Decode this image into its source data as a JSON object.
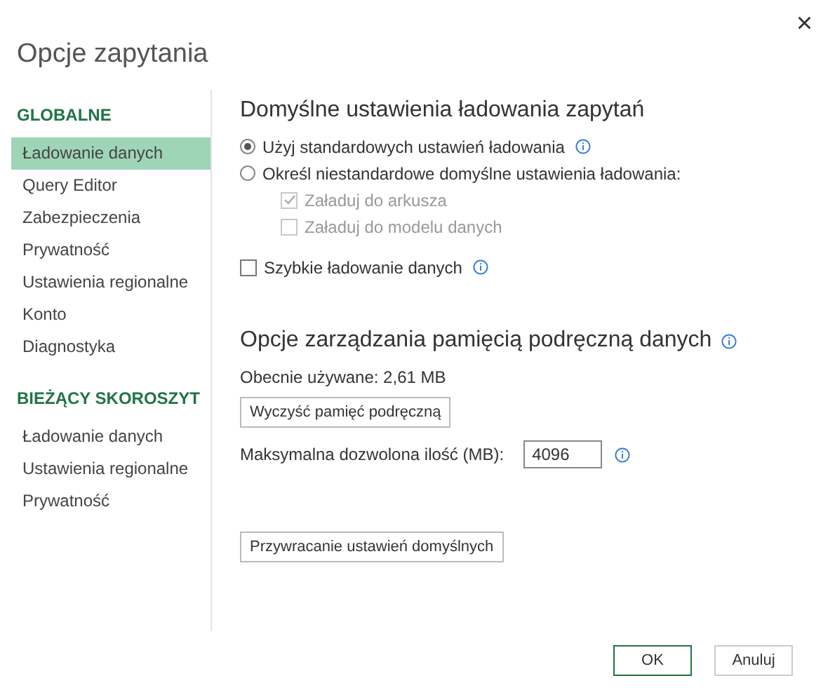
{
  "window": {
    "title": "Opcje zapytania",
    "close": "×"
  },
  "sidebar": {
    "sections": [
      {
        "heading": "GLOBALNE",
        "items": [
          {
            "label": "Ładowanie danych",
            "selected": true
          },
          {
            "label": "Query Editor",
            "selected": false
          },
          {
            "label": "Zabezpieczenia",
            "selected": false
          },
          {
            "label": "Prywatność",
            "selected": false
          },
          {
            "label": "Ustawienia regionalne",
            "selected": false
          },
          {
            "label": "Konto",
            "selected": false
          },
          {
            "label": "Diagnostyka",
            "selected": false
          }
        ]
      },
      {
        "heading": "BIEŻĄCY SKOROSZYT",
        "items": [
          {
            "label": "Ładowanie danych",
            "selected": false
          },
          {
            "label": "Ustawienia regionalne",
            "selected": false
          },
          {
            "label": "Prywatność",
            "selected": false
          }
        ]
      }
    ]
  },
  "load_settings": {
    "heading": "Domyślne ustawienia ładowania zapytań",
    "options": [
      {
        "label": "Użyj standardowych ustawień ładowania",
        "selected": true,
        "info": true
      },
      {
        "label": "Określ niestandardowe domyślne ustawienia ładowania:",
        "selected": false,
        "info": false,
        "children": [
          {
            "label": "Załaduj do arkusza",
            "checked": true,
            "disabled": true
          },
          {
            "label": "Załaduj do modelu danych",
            "checked": false,
            "disabled": true
          }
        ]
      }
    ],
    "fast_load": {
      "label": "Szybkie ładowanie danych",
      "checked": false,
      "info": true
    }
  },
  "cache": {
    "heading": "Opcje zarządzania pamięcią podręczną danych",
    "current": "Obecnie używane: 2,61 MB",
    "clear_button": "Wyczyść pamięć podręczną",
    "max_label": "Maksymalna dozwolona ilość (MB):",
    "max_value": "4096"
  },
  "restore_button": "Przywracanie ustawień domyślnych",
  "buttons": [
    {
      "label": "OK",
      "kind": "primary"
    },
    {
      "label": "Anuluj",
      "kind": "secondary"
    }
  ]
}
